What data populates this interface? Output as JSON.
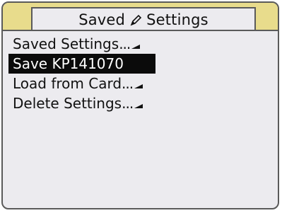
{
  "header": {
    "title_left": "Saved",
    "title_right": "Settings",
    "title_icon": "pencil-icon"
  },
  "menu": {
    "items": [
      {
        "label": "Saved Settings",
        "suffix": "...",
        "has_submenu": true,
        "selected": false
      },
      {
        "label": "Save KP141070",
        "suffix": "",
        "has_submenu": false,
        "selected": true
      },
      {
        "label": "Load from Card",
        "suffix": "...",
        "has_submenu": true,
        "selected": false
      },
      {
        "label": "Delete Settings",
        "suffix": "...",
        "has_submenu": true,
        "selected": false
      }
    ]
  },
  "colors": {
    "accent_strip": "#e8dc8c",
    "background": "#ecebef",
    "selection": "#0b0b0b"
  }
}
